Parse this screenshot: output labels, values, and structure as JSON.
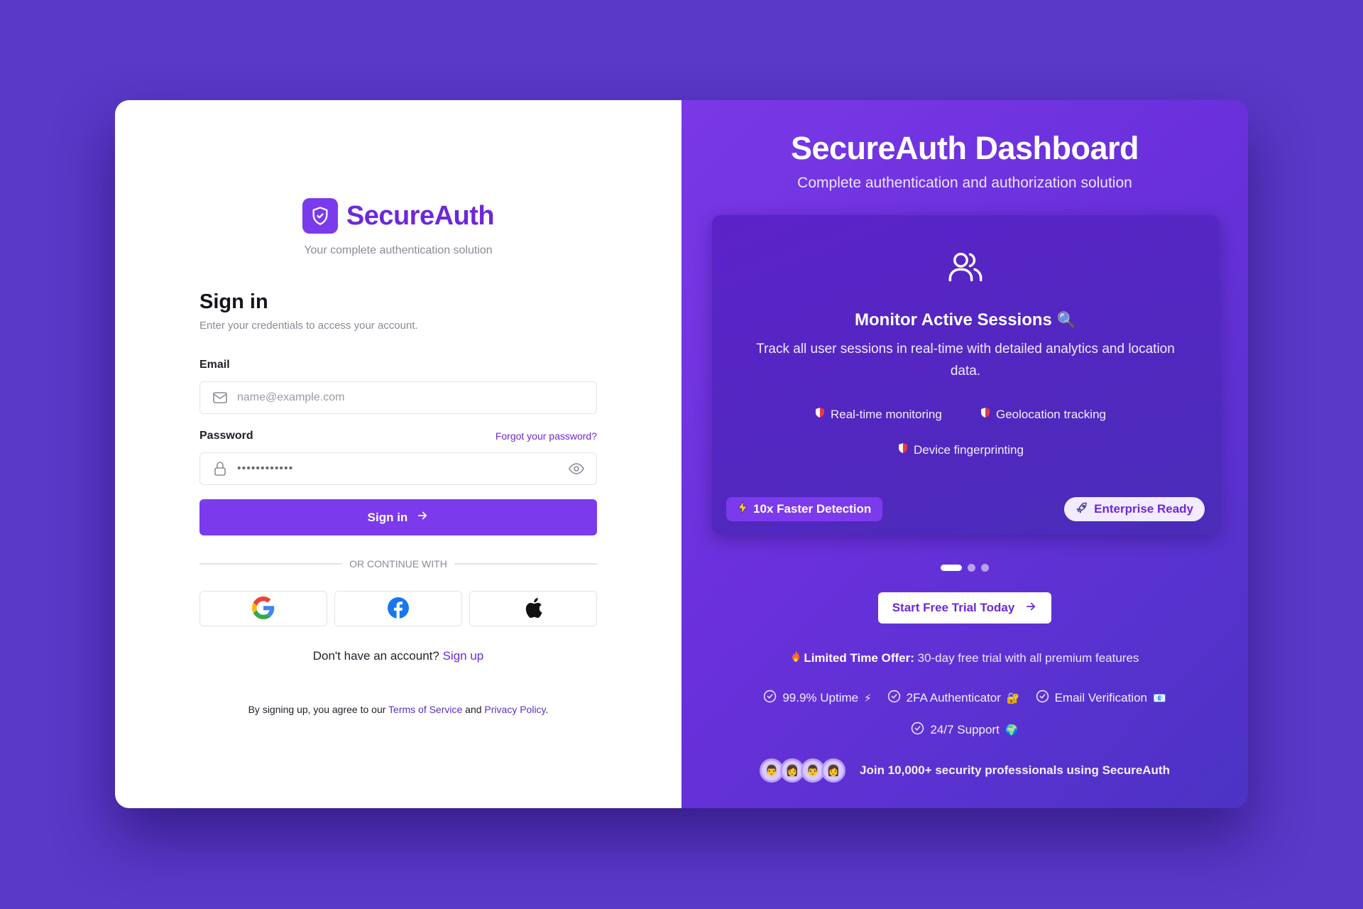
{
  "brand": {
    "name": "SecureAuth",
    "tagline": "Your complete authentication solution"
  },
  "signin": {
    "title": "Sign in",
    "subtitle": "Enter your credentials to access your account.",
    "email_label": "Email",
    "email_placeholder": "name@example.com",
    "password_label": "Password",
    "forgot_link": "Forgot your password?",
    "password_value": "••••••••••••",
    "submit_label": "Sign in",
    "divider_text": "OR CONTINUE WITH",
    "social": [
      "google-icon",
      "facebook-icon",
      "apple-icon"
    ],
    "no_account_text": "Don't have an account?",
    "signup_link": "Sign up",
    "terms_prefix": "By signing up, you agree to our",
    "terms_link": "Terms of Service",
    "terms_and": "and",
    "privacy_link": "Privacy Policy",
    "terms_suffix": "."
  },
  "promo": {
    "title": "SecureAuth Dashboard",
    "subtitle": "Complete authentication and authorization solution",
    "slide": {
      "icon": "users-icon",
      "title": "Monitor Active Sessions",
      "title_emoji": "🔍",
      "description": "Track all user sessions in real-time with detailed analytics and location data.",
      "features": [
        "Real-time monitoring",
        "Geolocation tracking",
        "Device fingerprinting"
      ],
      "badge_left": "10x Faster Detection",
      "badge_right": "Enterprise Ready"
    },
    "carousel": {
      "total": 3,
      "active": 1
    },
    "cta_label": "Start Free Trial Today",
    "offer_bold": "Limited Time Offer:",
    "offer_text": "30-day free trial with all premium features",
    "checks": [
      {
        "label": "99.9% Uptime",
        "emoji": "⚡"
      },
      {
        "label": "2FA Authenticator",
        "emoji": "🔐"
      },
      {
        "label": "Email Verification",
        "emoji": "📧"
      },
      {
        "label": "24/7 Support",
        "emoji": "🌍"
      }
    ],
    "join_text": "Join 10,000+ security professionals using SecureAuth"
  },
  "colors": {
    "accent": "#7c3aed",
    "accent_text": "#6d28d9",
    "background": "#5a38c8"
  }
}
